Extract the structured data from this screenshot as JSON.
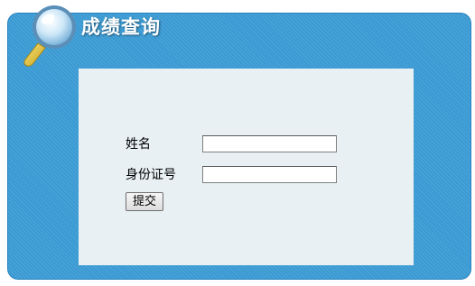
{
  "header": {
    "title": "成绩查询",
    "icon": "magnifier-icon"
  },
  "form": {
    "name_label": "姓名",
    "name_value": "",
    "id_label": "身份证号",
    "id_value": "",
    "submit_label": "提交"
  },
  "colors": {
    "panel_blue": "#3a9ad3",
    "content_bg": "#e8f0f4"
  }
}
